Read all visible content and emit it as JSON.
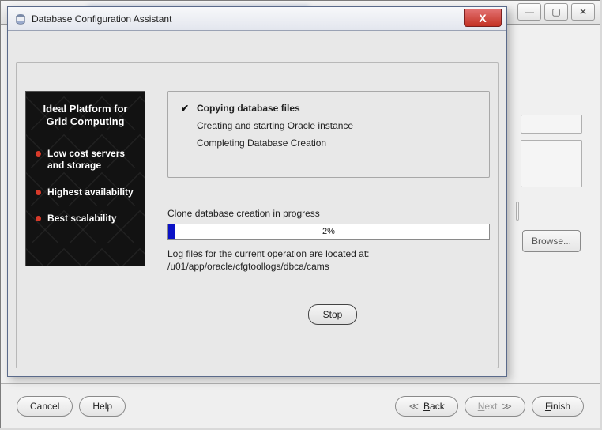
{
  "parent_window": {
    "controls": {
      "minimize_glyph": "—",
      "maximize_glyph": "▢",
      "close_glyph": "✕"
    },
    "browse_label": "Browse...",
    "buttons": {
      "cancel": "Cancel",
      "help": "Help",
      "back": "Back",
      "next": "Next",
      "finish": "Finish",
      "back_chev": "≪",
      "next_chev": "≫"
    }
  },
  "modal": {
    "title": "Database Configuration Assistant",
    "close_glyph": "X",
    "promo": {
      "title": "Ideal Platform for Grid Computing",
      "bullets": [
        "Low cost servers and storage",
        "Highest availability",
        "Best scalability"
      ]
    },
    "steps": [
      {
        "done": true,
        "label": "Copying database files"
      },
      {
        "done": false,
        "label": "Creating and starting Oracle instance"
      },
      {
        "done": false,
        "label": "Completing Database Creation"
      }
    ],
    "progress": {
      "label": "Clone database creation in progress",
      "percent": 2,
      "text": "2%"
    },
    "log_msg": "Log files for the current operation are located at:",
    "log_path": "/u01/app/oracle/cfgtoollogs/dbca/cams",
    "stop_label": "Stop"
  }
}
